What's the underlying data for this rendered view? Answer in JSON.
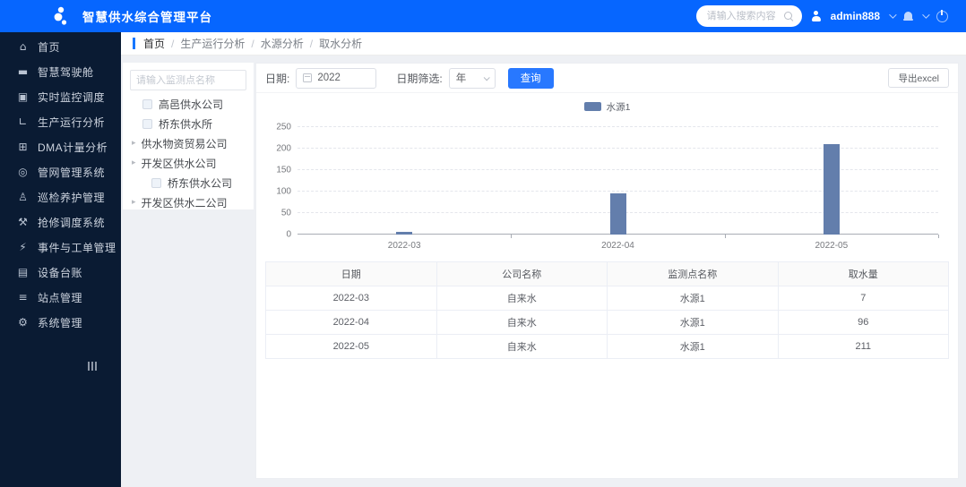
{
  "header": {
    "title": "智慧供水综合管理平台",
    "search_placeholder": "请输入搜索内容",
    "username": "admin888"
  },
  "icons": {
    "home": "⌂",
    "dashboard": "▬",
    "monitor": "▣",
    "chart": "∟",
    "meter": "⊞",
    "pipe": "◎",
    "patrol": "♙",
    "repair": "⚒",
    "event": "⚡",
    "ledger": "▤",
    "station": "≡",
    "gear": "⚙"
  },
  "sidebar": {
    "items": [
      {
        "label": "首页",
        "icon": "home"
      },
      {
        "label": "智慧驾驶舱",
        "icon": "dashboard"
      },
      {
        "label": "实时监控调度",
        "icon": "monitor"
      },
      {
        "label": "生产运行分析",
        "icon": "chart"
      },
      {
        "label": "DMA计量分析",
        "icon": "meter"
      },
      {
        "label": "管网管理系统",
        "icon": "pipe"
      },
      {
        "label": "巡检养护管理",
        "icon": "patrol"
      },
      {
        "label": "抢修调度系统",
        "icon": "repair"
      },
      {
        "label": "事件与工单管理",
        "icon": "event"
      },
      {
        "label": "设备台账",
        "icon": "ledger"
      },
      {
        "label": "站点管理",
        "icon": "station"
      },
      {
        "label": "系统管理",
        "icon": "gear"
      }
    ]
  },
  "breadcrumb": [
    "首页",
    "生产运行分析",
    "水源分析",
    "取水分析"
  ],
  "tree": {
    "search_placeholder": "请输入监测点名称",
    "items": [
      {
        "label": "高邑供水公司",
        "type": "leaf",
        "indent": 1
      },
      {
        "label": "桥东供水所",
        "type": "leaf",
        "indent": 1
      },
      {
        "label": "供水物资贸易公司",
        "type": "branch",
        "indent": 0
      },
      {
        "label": "开发区供水公司",
        "type": "branch",
        "indent": 0
      },
      {
        "label": "桥东供水公司",
        "type": "leaf",
        "indent": 2
      },
      {
        "label": "开发区供水二公司",
        "type": "branch",
        "indent": 0
      }
    ]
  },
  "toolbar": {
    "date_label": "日期:",
    "date_value": "2022",
    "filter_label": "日期筛选:",
    "filter_value": "年",
    "query_label": "查询",
    "export_label": "导出excel"
  },
  "chart_data": {
    "type": "bar",
    "categories": [
      "2022-03",
      "2022-04",
      "2022-05"
    ],
    "series": [
      {
        "name": "水源1",
        "values": [
          7,
          96,
          211
        ]
      }
    ],
    "title": "",
    "xlabel": "",
    "ylabel": "",
    "ylim": [
      0,
      250
    ],
    "yticks": [
      0,
      50,
      100,
      150,
      200,
      250
    ],
    "legend_position": "top-center",
    "grid": "dashed-horizontal",
    "bar_color": "#637eac"
  },
  "table": {
    "headers": [
      "日期",
      "公司名称",
      "监测点名称",
      "取水量"
    ],
    "rows": [
      [
        "2022-03",
        "自来水",
        "水源1",
        "7"
      ],
      [
        "2022-04",
        "自来水",
        "水源1",
        "96"
      ],
      [
        "2022-05",
        "自来水",
        "水源1",
        "211"
      ]
    ]
  }
}
